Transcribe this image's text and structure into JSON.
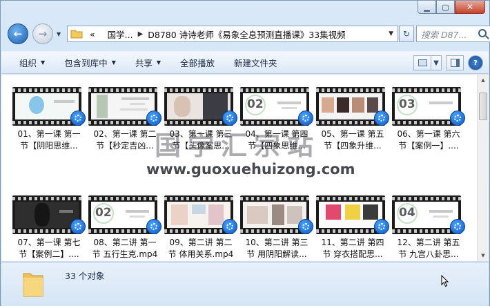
{
  "window": {
    "caption_min": "▁",
    "caption_max": "▢",
    "caption_close": "✕"
  },
  "nav": {
    "back_glyph": "←",
    "forward_glyph": "→",
    "history_glyph": "▼"
  },
  "address": {
    "lead_sep": "«",
    "crumbs": [
      "国学...",
      "D8780 诗诗老师《易象全息预测直播课》33集视频"
    ],
    "sep": "▶",
    "dropdown": "▼"
  },
  "refresh_glyph": "↻",
  "search": {
    "placeholder": "搜索 D87..."
  },
  "toolbar": {
    "organize": "组织",
    "include": "包含到库中",
    "share": "共享",
    "play_all": "全部播放",
    "new_folder": "新建文件夹",
    "caret": "▼"
  },
  "files": [
    {
      "line1": "01、第一课 第一",
      "line2": "节【阴阳思维..."
    },
    {
      "line1": "02、第一课 第二",
      "line2": "节【秒定吉凶..."
    },
    {
      "line1": "03、第一课 第三",
      "line2": "节【头像案思..."
    },
    {
      "line1": "04、第一课 第四",
      "line2": "节【四象思维..."
    },
    {
      "line1": "05、第一课 第五",
      "line2": "节【四象升维..."
    },
    {
      "line1": "06、第一课 第六",
      "line2": "节【案例一】...."
    },
    {
      "line1": "07、第一课 第七",
      "line2": "节【案例二】...."
    },
    {
      "line1": "08、第二讲 第一",
      "line2": "节 五行生克.mp4"
    },
    {
      "line1": "09、第二讲 第二",
      "line2": "节 体用关系.mp4"
    },
    {
      "line1": "10、第二讲 第三",
      "line2": "节 用阴阳解读..."
    },
    {
      "line1": "11、第二讲 第四",
      "line2": "节 穿衣搭配思..."
    },
    {
      "line1": "12、第二讲 第五",
      "line2": "节 九宫八卦思..."
    }
  ],
  "thumb_numbers": {
    "t4": "02",
    "t6": "03",
    "t8": "02",
    "t12": "04"
  },
  "scroll": {
    "up": "▲",
    "down": "▼"
  },
  "watermark": {
    "cn": "国学汇宗站",
    "url": "www.guoxuehuizong.com"
  },
  "status": {
    "count": "33 个对象"
  }
}
